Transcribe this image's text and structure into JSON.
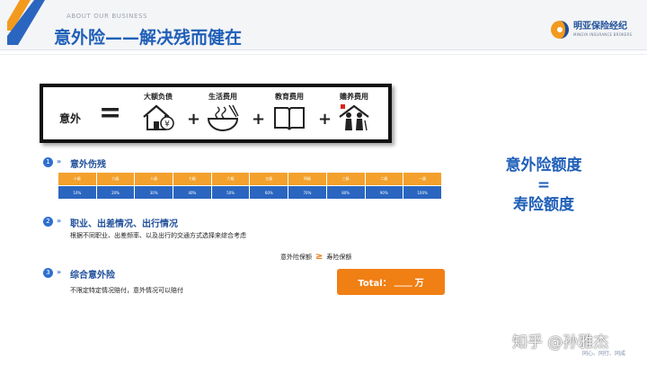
{
  "header": {
    "subtitle": "ABOUT OUR BUSINESS",
    "title": "意外险——解决残而健在",
    "brand_cn": "明亚保险经纪",
    "brand_en": "MINGYA INSURANCE BROKERS"
  },
  "formula": {
    "label": "意外",
    "equals": "=",
    "plus": "+",
    "items": [
      {
        "label": "大额负债",
        "icon": "house-yen-icon"
      },
      {
        "label": "生活费用",
        "icon": "food-bowl-icon"
      },
      {
        "label": "教育费用",
        "icon": "book-icon"
      },
      {
        "label": "赡养费用",
        "icon": "elderly-care-icon"
      }
    ]
  },
  "sections": [
    {
      "num": "1",
      "arrow": "»",
      "title": "意外伤残",
      "desc": ""
    },
    {
      "num": "2",
      "arrow": "»",
      "title": "职业、出差情况、出行情况",
      "desc": "根据不同职业、出差频率、以及出行的交通方式选择来综合考虑"
    },
    {
      "num": "3",
      "arrow": "»",
      "title": "综合意外险",
      "desc": "不限定特定情况赔付，意外情况可以赔付"
    }
  ],
  "disability_table": {
    "grades": [
      "十级",
      "九级",
      "八级",
      "七级",
      "六级",
      "五级",
      "四级",
      "三级",
      "二级",
      "一级"
    ],
    "ratios": [
      "10%",
      "20%",
      "30%",
      "40%",
      "50%",
      "60%",
      "70%",
      "80%",
      "90%",
      "100%"
    ]
  },
  "comparison": {
    "left": "意外险保额",
    "symbol": "≥",
    "right": "寿险保额"
  },
  "total": {
    "label": "Total：",
    "blank": "____",
    "unit": "万"
  },
  "right_panel": {
    "line1": "意外险额度",
    "line2": "=",
    "line3": "寿险额度"
  },
  "watermark": "知乎 @孙雅杰",
  "slogan": "同心、同行、同成",
  "colors": {
    "primary_blue": "#1f5fb8",
    "table_orange": "#f3a12c",
    "table_blue": "#2a66c0",
    "total_orange": "#f07f14"
  }
}
